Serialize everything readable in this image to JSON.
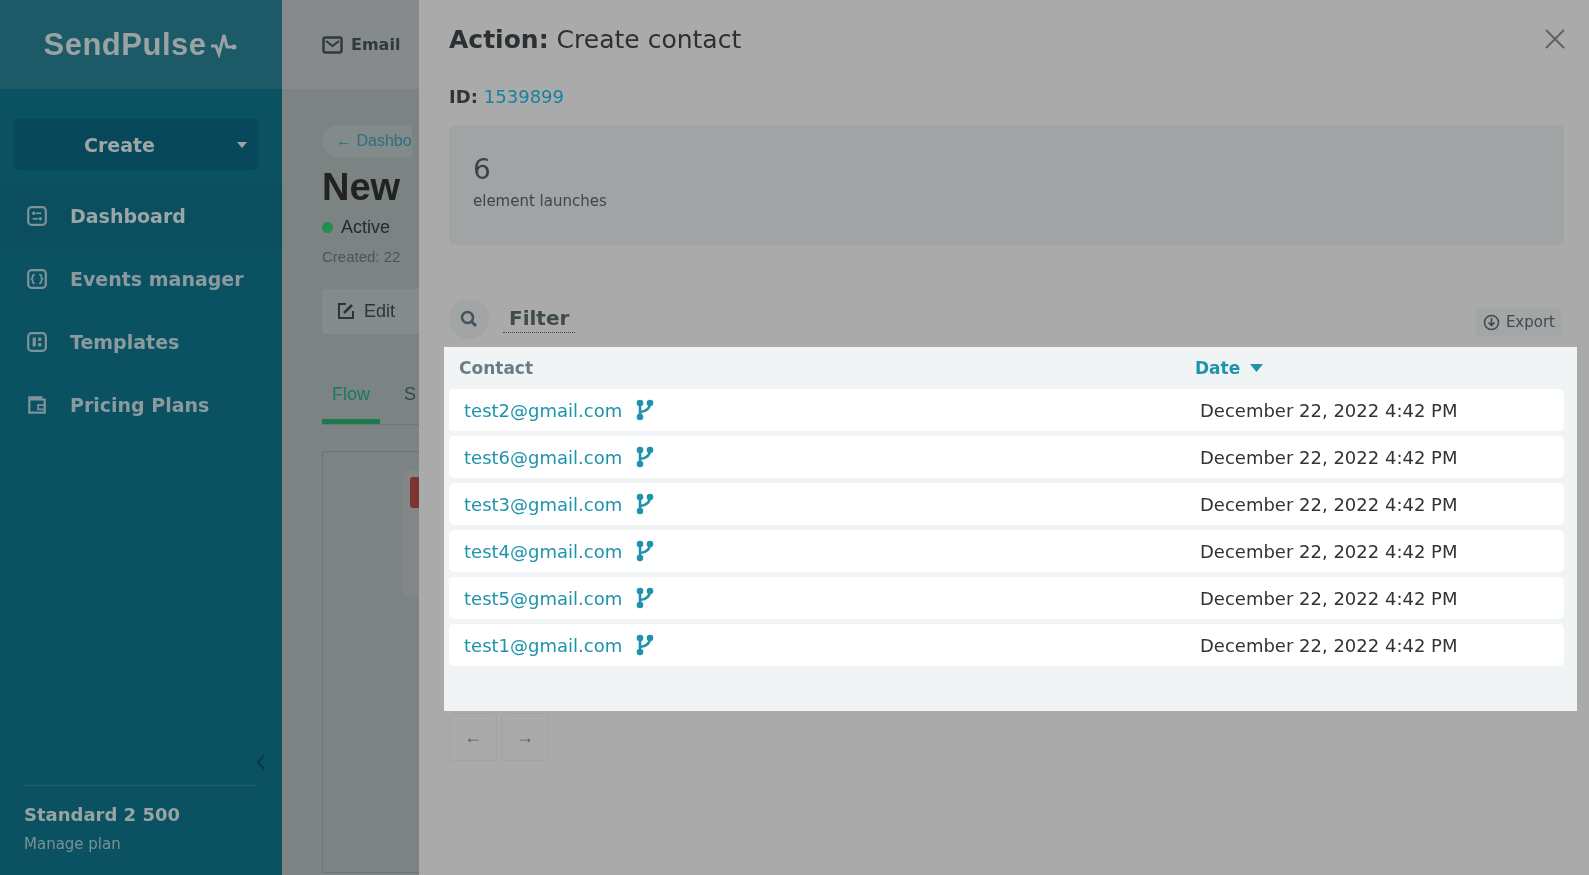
{
  "sidebar": {
    "logo": "SendPulse",
    "create_button": "Create",
    "items": [
      {
        "label": "Dashboard",
        "selected": true
      },
      {
        "label": "Events manager",
        "selected": false
      },
      {
        "label": "Templates",
        "selected": false
      },
      {
        "label": "Pricing Plans",
        "selected": false
      }
    ],
    "plan": "Standard 2 500",
    "manage_link": "Manage plan"
  },
  "background_page": {
    "top_tab": "Email",
    "breadcrumb": "← Dashbo",
    "title": "New",
    "status": "Active",
    "created": "Created: 22",
    "edit_button": "Edit",
    "tabs": [
      {
        "label": "Flow",
        "selected": true
      },
      {
        "label": "S",
        "selected": false
      }
    ]
  },
  "panel": {
    "title": "**Action:** Create contact",
    "id_label": "ID:",
    "id_value": "1539899",
    "stat_value": "6",
    "stat_label": "element launches",
    "filter": "Filter",
    "export": "Export",
    "columns": [
      {
        "label": "Contact",
        "sorted": false
      },
      {
        "label": "Date",
        "sorted": true
      }
    ],
    "rows": [
      {
        "contact": "test2@gmail.com",
        "date": "December 22, 2022 4:42 PM"
      },
      {
        "contact": "test6@gmail.com",
        "date": "December 22, 2022 4:42 PM"
      },
      {
        "contact": "test3@gmail.com",
        "date": "December 22, 2022 4:42 PM"
      },
      {
        "contact": "test4@gmail.com",
        "date": "December 22, 2022 4:42 PM"
      },
      {
        "contact": "test5@gmail.com",
        "date": "December 22, 2022 4:42 PM"
      },
      {
        "contact": "test1@gmail.com",
        "date": "December 22, 2022 4:42 PM"
      }
    ],
    "pagination": [
      {
        "label": "←",
        "disabled": true
      },
      {
        "label": "→",
        "disabled": true
      }
    ]
  }
}
